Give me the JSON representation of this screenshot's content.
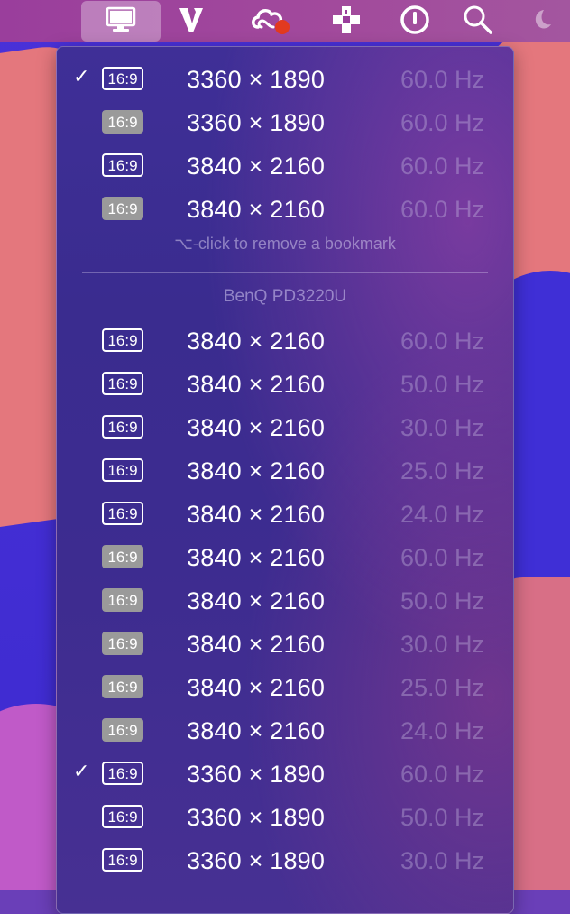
{
  "menubar": {
    "icons": [
      "display-icon",
      "v-app-icon",
      "creative-cloud-icon",
      "game-controller-icon",
      "power-icon",
      "search-icon",
      "moon-icon"
    ]
  },
  "menu": {
    "bookmarks": [
      {
        "checked": true,
        "ratio": "16:9",
        "ratio_style": "outline",
        "resolution": "3360 × 1890",
        "refresh": "60.0 Hz"
      },
      {
        "checked": false,
        "ratio": "16:9",
        "ratio_style": "filled",
        "resolution": "3360 × 1890",
        "refresh": "60.0 Hz"
      },
      {
        "checked": false,
        "ratio": "16:9",
        "ratio_style": "outline",
        "resolution": "3840 × 2160",
        "refresh": "60.0 Hz"
      },
      {
        "checked": false,
        "ratio": "16:9",
        "ratio_style": "filled",
        "resolution": "3840 × 2160",
        "refresh": "60.0 Hz"
      }
    ],
    "hint": "⌥-click to remove a bookmark",
    "section_title": "BenQ PD3220U",
    "modes": [
      {
        "checked": false,
        "ratio": "16:9",
        "ratio_style": "outline",
        "resolution": "3840 × 2160",
        "refresh": "60.0 Hz"
      },
      {
        "checked": false,
        "ratio": "16:9",
        "ratio_style": "outline",
        "resolution": "3840 × 2160",
        "refresh": "50.0 Hz"
      },
      {
        "checked": false,
        "ratio": "16:9",
        "ratio_style": "outline",
        "resolution": "3840 × 2160",
        "refresh": "30.0 Hz"
      },
      {
        "checked": false,
        "ratio": "16:9",
        "ratio_style": "outline",
        "resolution": "3840 × 2160",
        "refresh": "25.0 Hz"
      },
      {
        "checked": false,
        "ratio": "16:9",
        "ratio_style": "outline",
        "resolution": "3840 × 2160",
        "refresh": "24.0 Hz"
      },
      {
        "checked": false,
        "ratio": "16:9",
        "ratio_style": "filled",
        "resolution": "3840 × 2160",
        "refresh": "60.0 Hz"
      },
      {
        "checked": false,
        "ratio": "16:9",
        "ratio_style": "filled",
        "resolution": "3840 × 2160",
        "refresh": "50.0 Hz"
      },
      {
        "checked": false,
        "ratio": "16:9",
        "ratio_style": "filled",
        "resolution": "3840 × 2160",
        "refresh": "30.0 Hz"
      },
      {
        "checked": false,
        "ratio": "16:9",
        "ratio_style": "filled",
        "resolution": "3840 × 2160",
        "refresh": "25.0 Hz"
      },
      {
        "checked": false,
        "ratio": "16:9",
        "ratio_style": "filled",
        "resolution": "3840 × 2160",
        "refresh": "24.0 Hz"
      },
      {
        "checked": true,
        "ratio": "16:9",
        "ratio_style": "outline",
        "resolution": "3360 × 1890",
        "refresh": "60.0 Hz"
      },
      {
        "checked": false,
        "ratio": "16:9",
        "ratio_style": "outline",
        "resolution": "3360 × 1890",
        "refresh": "50.0 Hz"
      },
      {
        "checked": false,
        "ratio": "16:9",
        "ratio_style": "outline",
        "resolution": "3360 × 1890",
        "refresh": "30.0 Hz"
      }
    ],
    "checkmark": "✓"
  },
  "colors": {
    "menu_background": "#3d2c90",
    "menubar_background": "#9a3e9c",
    "refresh_text": "#c8bee1",
    "ratio_filled": "#9a9a9a"
  }
}
